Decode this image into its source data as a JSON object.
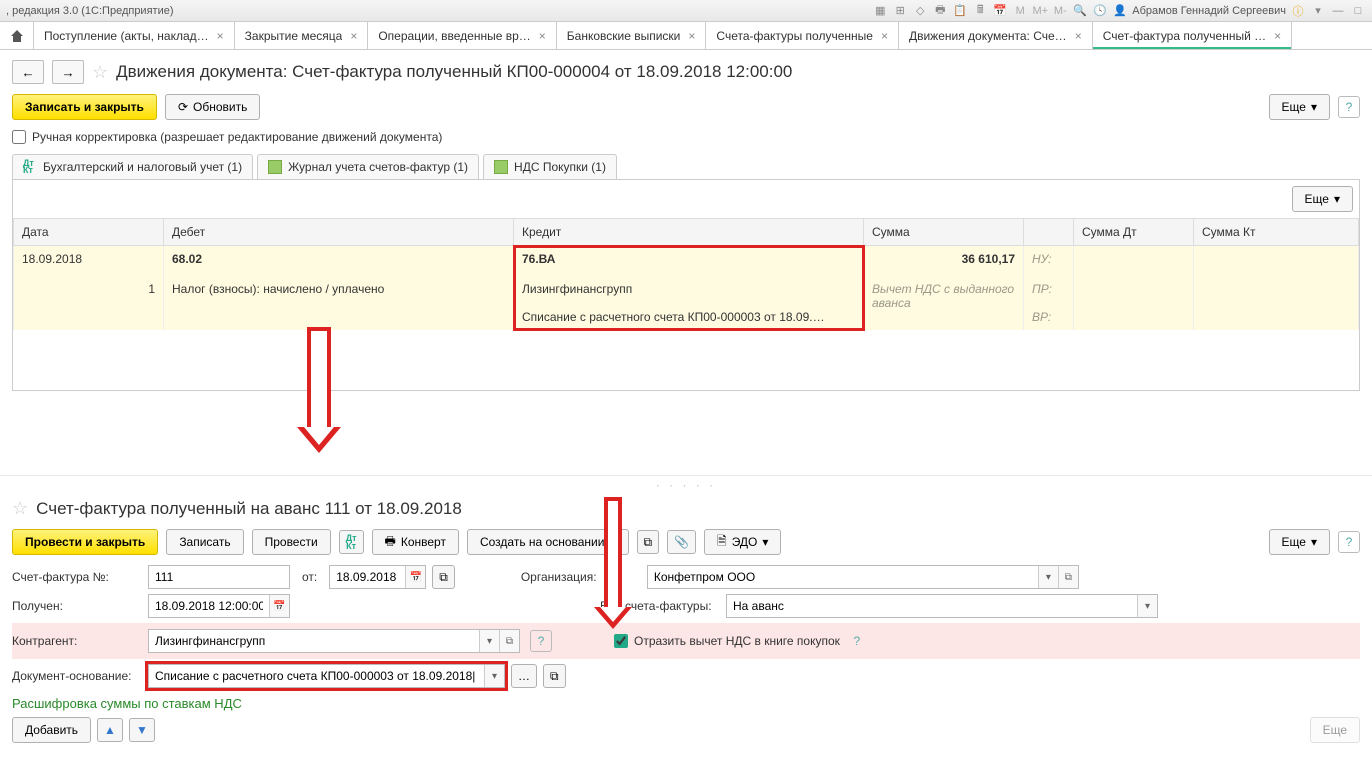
{
  "titlebar": {
    "left": ", редакция 3.0 (1С:Предприятие)",
    "user": "Абрамов Геннадий Сергеевич"
  },
  "tabs": [
    {
      "label": "Поступление (акты, наклад…"
    },
    {
      "label": "Закрытие месяца"
    },
    {
      "label": "Операции, введенные вр…"
    },
    {
      "label": "Банковские выписки"
    },
    {
      "label": "Счета-фактуры полученные"
    },
    {
      "label": "Движения документа: Сче…"
    },
    {
      "label": "Счет-фактура полученный …",
      "active": true
    }
  ],
  "page1": {
    "title": "Движения документа: Счет-фактура полученный КП00-000004 от 18.09.2018 12:00:00",
    "btn_save": "Записать и закрыть",
    "btn_refresh": "Обновить",
    "btn_more": "Еще",
    "chk_label": "Ручная корректировка (разрешает редактирование движений документа)",
    "subtabs": [
      {
        "label": "Бухгалтерский и налоговый учет (1)"
      },
      {
        "label": "Журнал учета счетов-фактур (1)"
      },
      {
        "label": "НДС Покупки (1)"
      }
    ],
    "grid": {
      "headers": [
        "Дата",
        "Дебет",
        "Кредит",
        "Сумма",
        "",
        "Сумма Дт",
        "Сумма Кт"
      ],
      "row": {
        "date": "18.09.2018",
        "num": "1",
        "debit_acc": "68.02",
        "debit_sub": "Налог (взносы): начислено / уплачено",
        "credit_acc": "76.ВА",
        "credit_sub1": "Лизингфинансгрупп",
        "credit_sub2": "Списание с расчетного счета КП00-000003 от 18.09.…",
        "sum": "36 610,17",
        "sum_desc": "Вычет НДС с выданного аванса",
        "nu": "НУ:",
        "pr": "ПР:",
        "vr": "ВР:"
      }
    }
  },
  "page2": {
    "title": "Счет-фактура полученный на аванс 111 от 18.09.2018",
    "btn_post": "Провести и закрыть",
    "btn_save": "Записать",
    "btn_post2": "Провести",
    "btn_convert": "Конверт",
    "btn_create_base": "Создать на основании",
    "btn_edo": "ЭДО",
    "btn_more": "Еще",
    "fields": {
      "sf_no_lbl": "Счет-фактура №:",
      "sf_no": "111",
      "from_lbl": "от:",
      "from_date": "18.09.2018",
      "org_lbl": "Организация:",
      "org": "Конфетпром ООО",
      "received_lbl": "Получен:",
      "received": "18.09.2018 12:00:00",
      "type_lbl": "Вид счета-фактуры:",
      "type": "На аванс",
      "contragent_lbl": "Контрагент:",
      "contragent": "Лизингфинансгрупп",
      "chk_vat": "Отразить вычет НДС в книге покупок",
      "doc_base_lbl": "Документ-основание:",
      "doc_base": "Списание с расчетного счета КП00-000003 от 18.09.2018|"
    },
    "breakdown_title": "Расшифровка суммы по ставкам НДС",
    "btn_add": "Добавить"
  }
}
